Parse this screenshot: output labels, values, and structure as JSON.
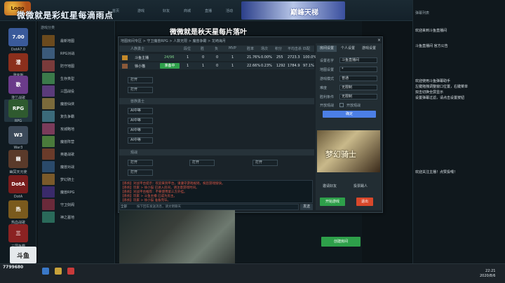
{
  "stream": {
    "overlay_text": "微微就是彩虹星每滴雨点",
    "room_title_a": "微微就是秋天",
    "room_title_b": "星每片落叶",
    "viewer_count": "7799680"
  },
  "top_tabs": [
    "首页",
    "游戏",
    "好友",
    "商城",
    "直播",
    "活动"
  ],
  "banner": {
    "title": "巅峰天梯"
  },
  "games": [
    {
      "label": "DotA7.0",
      "badge": "7.00",
      "color": "#3a5a9a"
    },
    {
      "label": "澄克斯",
      "badge": "澄",
      "color": "#8b2f1c"
    },
    {
      "label": "澄兰战歌",
      "badge": "歌",
      "color": "#6b3b8a"
    },
    {
      "label": "RPG",
      "badge": "RPG",
      "color": "#2f5a2f"
    },
    {
      "label": "War3",
      "badge": "W3",
      "color": "#3c4a5a"
    },
    {
      "label": "幽冥天元使",
      "badge": "幽",
      "color": "#5a3a2a"
    },
    {
      "label": "DotA",
      "badge": "DotA",
      "color": "#7a1d1d"
    },
    {
      "label": "热血战歌",
      "badge": "热",
      "color": "#7a5a1d"
    },
    {
      "label": "三国争霸",
      "badge": "三",
      "color": "#8b2222"
    }
  ],
  "map_list": {
    "header": "游戏分类",
    "items": [
      "最新地图",
      "RPG对战",
      "防守地图",
      "生存类型",
      "三国战役",
      "魔兽仙侠",
      "复仇争霸",
      "攻城略地",
      "魔兽阵营",
      "英雄战歌",
      "魔兽对战",
      "梦幻骑士",
      "魔兽RPG",
      "守卫剑阁",
      "神之墓地",
      "澄兰战记"
    ]
  },
  "dialog": {
    "path": "地图房间专区 > 守卫魔兽RPG > 人数无限 > 魔兽争霸 > 龙崎海月",
    "close": "×",
    "team1_header": "人族勇士",
    "columns": [
      "段位",
      "胜",
      "负",
      "MVP",
      "胜率",
      "场次",
      "积分",
      "平均击杀",
      "匹配"
    ],
    "players": [
      {
        "name": "斗鱼主播",
        "status": "24/96",
        "level": "1",
        "win": "0",
        "lose": "0",
        "mvp": "1",
        "rate": "21.76%",
        "matches": "0.00%",
        "score": "255",
        "avg": "2723.3",
        "match": "100.0%"
      },
      {
        "name": "徐小猫",
        "status": "准备中",
        "level": "1",
        "win": "1",
        "lose": "0",
        "mvp": "1",
        "rate": "22.66%",
        "matches": "0.23%",
        "score": "1292",
        "avg": "1784.9",
        "match": "97.1%"
      }
    ],
    "open_slots": [
      "打开",
      "打开"
    ],
    "team2_header": "兽族勇士",
    "ai_slots": [
      "AI中等",
      "AI中等",
      "AI中等",
      "AI中等"
    ],
    "team3_header": "观战",
    "watch_slots": [
      "打开",
      "打开",
      "打开",
      "打开",
      "打开"
    ]
  },
  "right_panel": {
    "tabs": [
      "房间设置",
      "个人设置",
      "游戏设置"
    ],
    "fields": [
      {
        "label": "设置名字",
        "value": "斗鱼直播间"
      },
      {
        "label": "地图设置",
        "value": "*"
      },
      {
        "label": "游戏模式",
        "value": "普通"
      },
      {
        "label": "难度",
        "value": "无限制"
      },
      {
        "label": "胜利条件",
        "value": "无限制"
      },
      {
        "label": "开放观战",
        "value": ""
      }
    ],
    "checkbox_label": "开放观战",
    "confirm": "确定",
    "ad_title": "梦幻骑士",
    "btn_invite": "邀请好友",
    "btn_kick": "投票踢人",
    "btn_start": "开始游戏",
    "btn_exit": "退出"
  },
  "chat": {
    "lines": [
      "【系统】对战平台提示：欢迎来到平台，请遵守游戏规则，祝您游戏愉快。",
      "【系统】玩家 > 徐小猫 已进入房间，请注意游戏时间。",
      "【系统】对战平台推荐：不要使用第三方外挂。",
      "【系统】玩家 > 斗鱼主播 已成为房主。",
      "【系统】玩家 > 徐小猫 准备完毕。"
    ],
    "input_placeholder": "按下回车发送消息，请文明聊天",
    "send": "发送",
    "channel": "全部"
  },
  "create_room": "创建房间",
  "right_sidebar": {
    "title": "弹幕列表",
    "messages": [
      "欢迎来到斗鱼直播间",
      "斗鱼直播间 官方公告",
      "欢迎使用斗鱼弹幕助手",
      "左键拖拽调整窗口位置，右键菜单",
      "双击切换全屏显示",
      "设置弹幕过滤，请点击设置按钮"
    ],
    "note": "欢迎关注主播！点赞投喂！"
  },
  "taskbar": {
    "time": "22:21",
    "date": "2020/8/6"
  }
}
